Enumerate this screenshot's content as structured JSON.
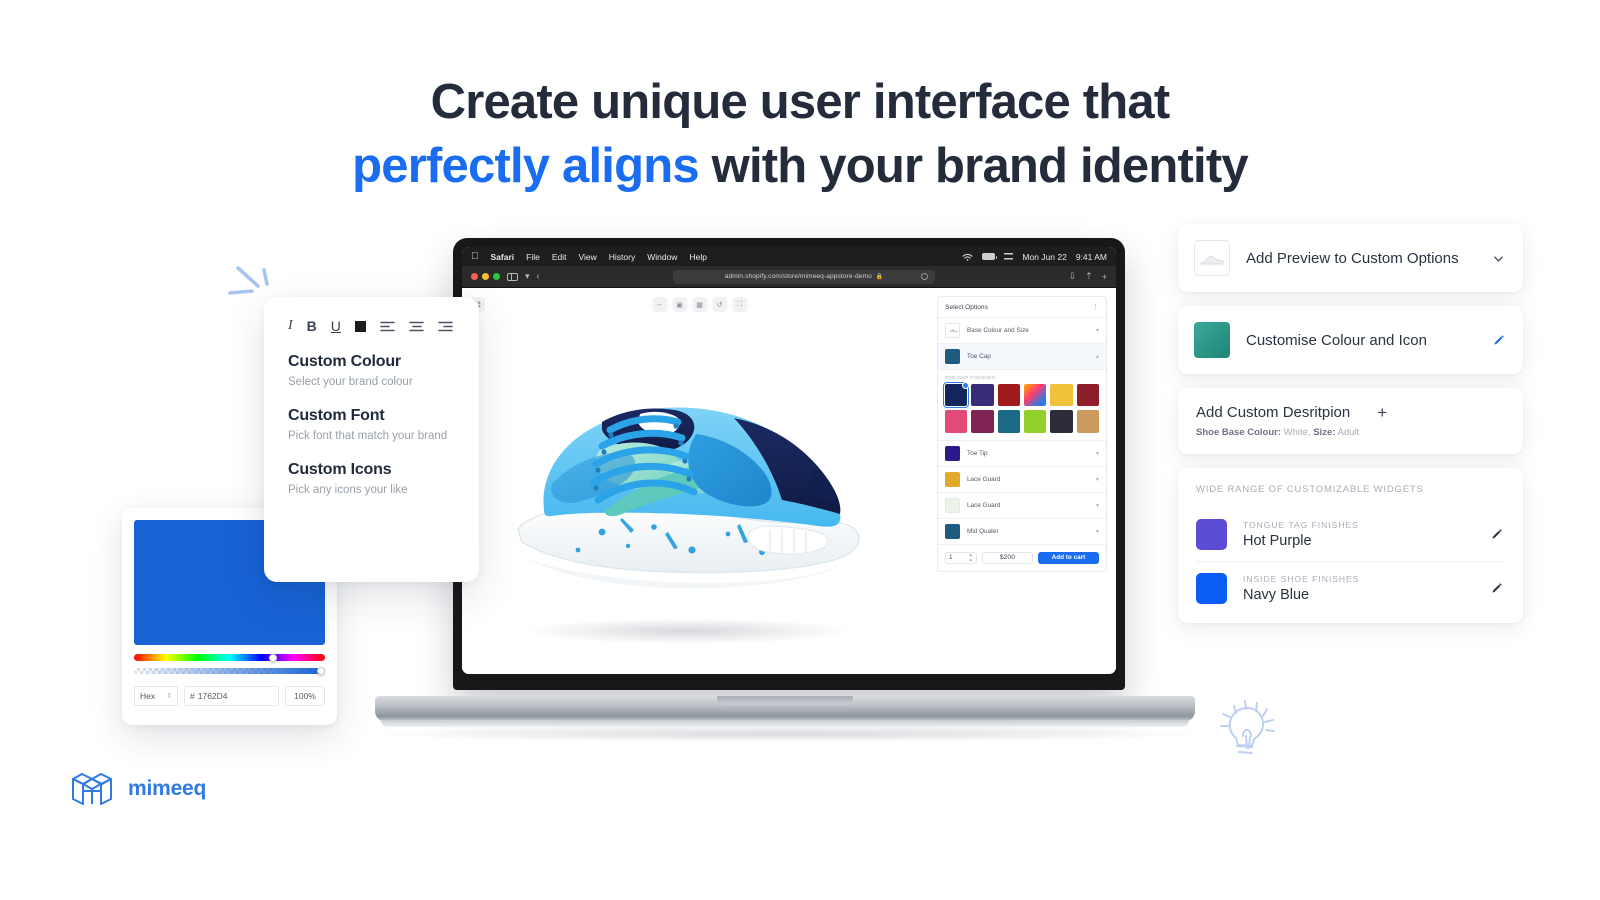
{
  "headline": {
    "line1": "Create unique user interface that",
    "line2_accent": "perfectly aligns",
    "line2_rest": " with your brand identity",
    "accent_color": "#1a6cf0",
    "text_color": "#242c3c"
  },
  "brand": {
    "name": "mimeeq",
    "logo_icon": "mimeeq-cube-logo",
    "color": "#2f7ae5"
  },
  "doodles": {
    "sparkle_icon": "sparkle-lines-doodle",
    "bulb_icon": "lightbulb-doodle",
    "color": "#b9cdf0"
  },
  "laptop": {
    "menubar": {
      "apple_icon": "apple-logo-icon",
      "items": [
        "Safari",
        "File",
        "Edit",
        "View",
        "History",
        "Window",
        "Help"
      ],
      "status": {
        "wifi_icon": "wifi-icon",
        "battery_icon": "battery-icon",
        "control_center_icon": "control-center-icon",
        "date": "Mon Jun 22",
        "time": "9:41 AM"
      }
    },
    "safari": {
      "traffic_lights": [
        "close",
        "minimize",
        "zoom"
      ],
      "sidebar_icon": "sidebar-toggle-icon",
      "sidebar_caret_icon": "chevron-down-icon",
      "back_icon": "chevron-left-icon",
      "url": "admin.shopify.com/store/mimeeq-appstore-demo",
      "lock_icon": "lock-icon",
      "reload_icon": "reload-icon",
      "download_icon": "download-icon",
      "share_icon": "share-icon",
      "newtab_icon": "plus-icon"
    },
    "canvas": {
      "grid_icon": "grid-dots-icon",
      "tools": [
        {
          "icon": "resize-icon",
          "name": "resize-tool"
        },
        {
          "icon": "screenshot-icon",
          "name": "screenshot-tool"
        },
        {
          "icon": "layers-icon",
          "name": "layers-tool"
        },
        {
          "icon": "rotate-icon",
          "name": "rotate-tool"
        },
        {
          "icon": "fullscreen-icon",
          "name": "fullscreen-tool"
        }
      ],
      "product_alt": "blue-nike-air-max-90-sneaker"
    },
    "options_panel": {
      "title": "Select Options",
      "kebab_icon": "more-options-icon",
      "rows": [
        {
          "label": "Base Colour and Size",
          "swatch": "thumbnail",
          "color": "#ffffff",
          "selected": false,
          "caret_icon": "chevron-down-icon"
        },
        {
          "label": "Toe Cap",
          "swatch": "solid",
          "color": "#1f5a80",
          "selected": true,
          "caret_icon": "chevron-up-icon"
        }
      ],
      "finishes": {
        "title": "TOE CAP FINISHES",
        "swatches": [
          {
            "name": "navy-solid",
            "color": "#14245c",
            "active": true
          },
          {
            "name": "purple-camo",
            "color": "#3a2a7a",
            "active": false
          },
          {
            "name": "red-camo",
            "color": "#a01c1c",
            "active": false
          },
          {
            "name": "rainbow-marble",
            "color": "#e0534b",
            "active": false
          },
          {
            "name": "yellow-leopard",
            "color": "#f0c23a",
            "active": false
          },
          {
            "name": "dark-red",
            "color": "#8e1f2a",
            "active": false
          },
          {
            "name": "pink-camo",
            "color": "#e24b77",
            "active": false
          },
          {
            "name": "magenta-camo",
            "color": "#7e2352",
            "active": false
          },
          {
            "name": "teal-solid",
            "color": "#1b6a85",
            "active": false
          },
          {
            "name": "green-leopard",
            "color": "#8fd02a",
            "active": false
          },
          {
            "name": "charcoal",
            "color": "#2d2d3a",
            "active": false
          },
          {
            "name": "tan",
            "color": "#cd9a5e",
            "active": false
          }
        ]
      },
      "rows2": [
        {
          "label": "Toe Tip",
          "color": "#2b1a8c",
          "caret_icon": "chevron-down-icon"
        },
        {
          "label": "Lace Guard",
          "color": "#e0a92a",
          "caret_icon": "chevron-down-icon"
        },
        {
          "label": "Lace Guard",
          "color": "#eef3ea",
          "caret_icon": "chevron-down-icon"
        },
        {
          "label": "Mid Quater",
          "color": "#1f5a80",
          "caret_icon": "chevron-down-icon"
        }
      ],
      "cart": {
        "quantity": "1",
        "stepper_up_icon": "caret-up-icon",
        "stepper_down_icon": "caret-down-icon",
        "price": "$200",
        "add_label": "Add to cart",
        "add_color": "#1a6cf0"
      }
    }
  },
  "custom_card": {
    "format_tools": [
      {
        "name": "italic-button",
        "label": "I"
      },
      {
        "name": "bold-button",
        "label": "B"
      },
      {
        "name": "underline-button",
        "label": "U"
      },
      {
        "name": "text-colour-button",
        "label": ""
      },
      {
        "name": "align-left-button",
        "label": ""
      },
      {
        "name": "align-center-button",
        "label": ""
      },
      {
        "name": "align-right-button",
        "label": ""
      }
    ],
    "items": [
      {
        "title": "Custom Colour",
        "sub": "Select your brand colour"
      },
      {
        "title": "Custom Font",
        "sub": "Pick font that match your brand"
      },
      {
        "title": "Custom Icons",
        "sub": "Pick any icons your like"
      }
    ]
  },
  "picker": {
    "color": "#1762D4",
    "hue_label": "Hex",
    "hue_caret_icon": "updown-caret-icon",
    "hash": "#",
    "hex_value": "1762D4",
    "opacity": "100%"
  },
  "right_panel": {
    "cards": [
      {
        "name": "add-preview-card",
        "thumb_kind": "shoe-thumbnail",
        "thumb_icon": "white-sneaker-thumbnail",
        "label": "Add Preview to Custom Options",
        "trail_icon": "chevron-down-icon",
        "trail_color": "#4b5362"
      },
      {
        "name": "customise-colour-card",
        "thumb_kind": "swatch",
        "thumb_color": "#2e9687",
        "label": "Customise Colour and Icon",
        "trail_icon": "pencil-icon",
        "trail_color": "#1a6cf0"
      }
    ],
    "description_card": {
      "title": "Add Custom Desritpion",
      "sub_label_1": "Shoe Base Colour:",
      "sub_value_1": "White,",
      "sub_label_2": "Size:",
      "sub_value_2": "Adult",
      "trail_icon": "plus-icon"
    },
    "widgets_card": {
      "title": "WIDE RANGE OF CUSTOMIZABLE WIDGETS",
      "rows": [
        {
          "kicker": "TONGUE TAG FINISHES",
          "name": "Hot Purple",
          "color": "#5b4cd6",
          "trail_icon": "pencil-icon"
        },
        {
          "kicker": "INSIDE SHOE FINISHES",
          "name": "Navy Blue",
          "color": "#0a5cf5",
          "trail_icon": "pencil-icon"
        }
      ]
    }
  }
}
